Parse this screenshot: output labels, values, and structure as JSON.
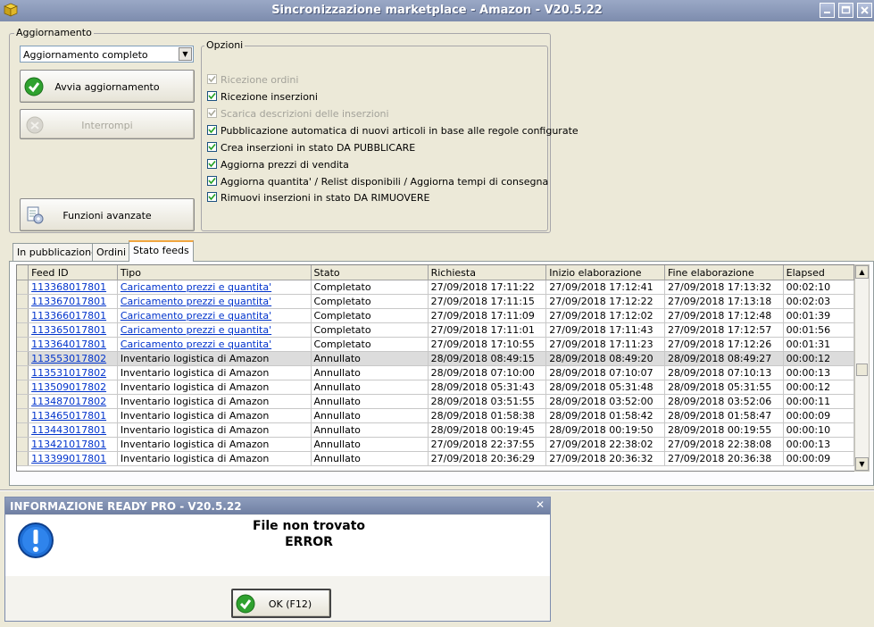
{
  "window": {
    "title": "Sincronizzazione marketplace - Amazon - V20.5.22",
    "controls": [
      "minimize",
      "maximize",
      "close"
    ]
  },
  "aggiornamento": {
    "group_label": "Aggiornamento",
    "mode_value": "Aggiornamento completo",
    "start_button": "Avvia aggiornamento",
    "stop_button": "Interrompi",
    "advanced_button": "Funzioni avanzate"
  },
  "opzioni": {
    "group_label": "Opzioni",
    "items": [
      {
        "label": "Ricezione ordini",
        "checked": true,
        "enabled": false
      },
      {
        "label": "Ricezione inserzioni",
        "checked": true,
        "enabled": true
      },
      {
        "label": "Scarica descrizioni delle inserzioni",
        "checked": true,
        "enabled": false
      },
      {
        "label": "Pubblicazione automatica di nuovi articoli in base alle regole configurate",
        "checked": true,
        "enabled": true
      },
      {
        "label": "Crea inserzioni in stato DA PUBBLICARE",
        "checked": true,
        "enabled": true
      },
      {
        "label": "Aggiorna prezzi di vendita",
        "checked": true,
        "enabled": true
      },
      {
        "label": "Aggiorna quantita' / Relist disponibili / Aggiorna tempi di consegna",
        "checked": true,
        "enabled": true
      },
      {
        "label": "Rimuovi inserzioni in stato DA RIMUOVERE",
        "checked": true,
        "enabled": true
      }
    ]
  },
  "tabs": [
    {
      "label": "In pubblicazione",
      "active": false
    },
    {
      "label": "Ordini",
      "active": false
    },
    {
      "label": "Stato feeds",
      "active": true
    }
  ],
  "feeds": {
    "columns": [
      "Feed ID",
      "Tipo",
      "Stato",
      "Richiesta",
      "Inizio elaborazione",
      "Fine elaborazione",
      "Elapsed"
    ],
    "rows": [
      {
        "id": "113368017801",
        "tipo": "Caricamento prezzi e quantita'",
        "tipo_link": true,
        "stato": "Completato",
        "richiesta": "27/09/2018 17:11:22",
        "inizio": "27/09/2018 17:12:41",
        "fine": "27/09/2018 17:13:32",
        "elapsed": "00:02:10",
        "selected": false
      },
      {
        "id": "113367017801",
        "tipo": "Caricamento prezzi e quantita'",
        "tipo_link": true,
        "stato": "Completato",
        "richiesta": "27/09/2018 17:11:15",
        "inizio": "27/09/2018 17:12:22",
        "fine": "27/09/2018 17:13:18",
        "elapsed": "00:02:03",
        "selected": false
      },
      {
        "id": "113366017801",
        "tipo": "Caricamento prezzi e quantita'",
        "tipo_link": true,
        "stato": "Completato",
        "richiesta": "27/09/2018 17:11:09",
        "inizio": "27/09/2018 17:12:02",
        "fine": "27/09/2018 17:12:48",
        "elapsed": "00:01:39",
        "selected": false
      },
      {
        "id": "113365017801",
        "tipo": "Caricamento prezzi e quantita'",
        "tipo_link": true,
        "stato": "Completato",
        "richiesta": "27/09/2018 17:11:01",
        "inizio": "27/09/2018 17:11:43",
        "fine": "27/09/2018 17:12:57",
        "elapsed": "00:01:56",
        "selected": false
      },
      {
        "id": "113364017801",
        "tipo": "Caricamento prezzi e quantita'",
        "tipo_link": true,
        "stato": "Completato",
        "richiesta": "27/09/2018 17:10:55",
        "inizio": "27/09/2018 17:11:23",
        "fine": "27/09/2018 17:12:26",
        "elapsed": "00:01:31",
        "selected": false
      },
      {
        "id": "113553017802",
        "tipo": "Inventario logistica di Amazon",
        "tipo_link": false,
        "stato": "Annullato",
        "richiesta": "28/09/2018 08:49:15",
        "inizio": "28/09/2018 08:49:20",
        "fine": "28/09/2018 08:49:27",
        "elapsed": "00:00:12",
        "selected": true
      },
      {
        "id": "113531017802",
        "tipo": "Inventario logistica di Amazon",
        "tipo_link": false,
        "stato": "Annullato",
        "richiesta": "28/09/2018 07:10:00",
        "inizio": "28/09/2018 07:10:07",
        "fine": "28/09/2018 07:10:13",
        "elapsed": "00:00:13",
        "selected": false
      },
      {
        "id": "113509017802",
        "tipo": "Inventario logistica di Amazon",
        "tipo_link": false,
        "stato": "Annullato",
        "richiesta": "28/09/2018 05:31:43",
        "inizio": "28/09/2018 05:31:48",
        "fine": "28/09/2018 05:31:55",
        "elapsed": "00:00:12",
        "selected": false
      },
      {
        "id": "113487017802",
        "tipo": "Inventario logistica di Amazon",
        "tipo_link": false,
        "stato": "Annullato",
        "richiesta": "28/09/2018 03:51:55",
        "inizio": "28/09/2018 03:52:00",
        "fine": "28/09/2018 03:52:06",
        "elapsed": "00:00:11",
        "selected": false
      },
      {
        "id": "113465017801",
        "tipo": "Inventario logistica di Amazon",
        "tipo_link": false,
        "stato": "Annullato",
        "richiesta": "28/09/2018 01:58:38",
        "inizio": "28/09/2018 01:58:42",
        "fine": "28/09/2018 01:58:47",
        "elapsed": "00:00:09",
        "selected": false
      },
      {
        "id": "113443017801",
        "tipo": "Inventario logistica di Amazon",
        "tipo_link": false,
        "stato": "Annullato",
        "richiesta": "28/09/2018 00:19:45",
        "inizio": "28/09/2018 00:19:50",
        "fine": "28/09/2018 00:19:55",
        "elapsed": "00:00:10",
        "selected": false
      },
      {
        "id": "113421017801",
        "tipo": "Inventario logistica di Amazon",
        "tipo_link": false,
        "stato": "Annullato",
        "richiesta": "27/09/2018 22:37:55",
        "inizio": "27/09/2018 22:38:02",
        "fine": "27/09/2018 22:38:08",
        "elapsed": "00:00:13",
        "selected": false
      },
      {
        "id": "113399017801",
        "tipo": "Inventario logistica di Amazon",
        "tipo_link": false,
        "stato": "Annullato",
        "richiesta": "27/09/2018 20:36:29",
        "inizio": "27/09/2018 20:36:32",
        "fine": "27/09/2018 20:36:38",
        "elapsed": "00:00:09",
        "selected": false
      }
    ]
  },
  "dialog": {
    "title": "INFORMAZIONE READY PRO - V20.5.22",
    "close_glyph": "✕",
    "message_line1": "File non trovato",
    "message_line2": "ERROR",
    "ok_button": "OK (F12)"
  },
  "colors": {
    "link": "#0033cc",
    "accent_tab": "#f0a540",
    "check_green": "#2fa12f"
  }
}
